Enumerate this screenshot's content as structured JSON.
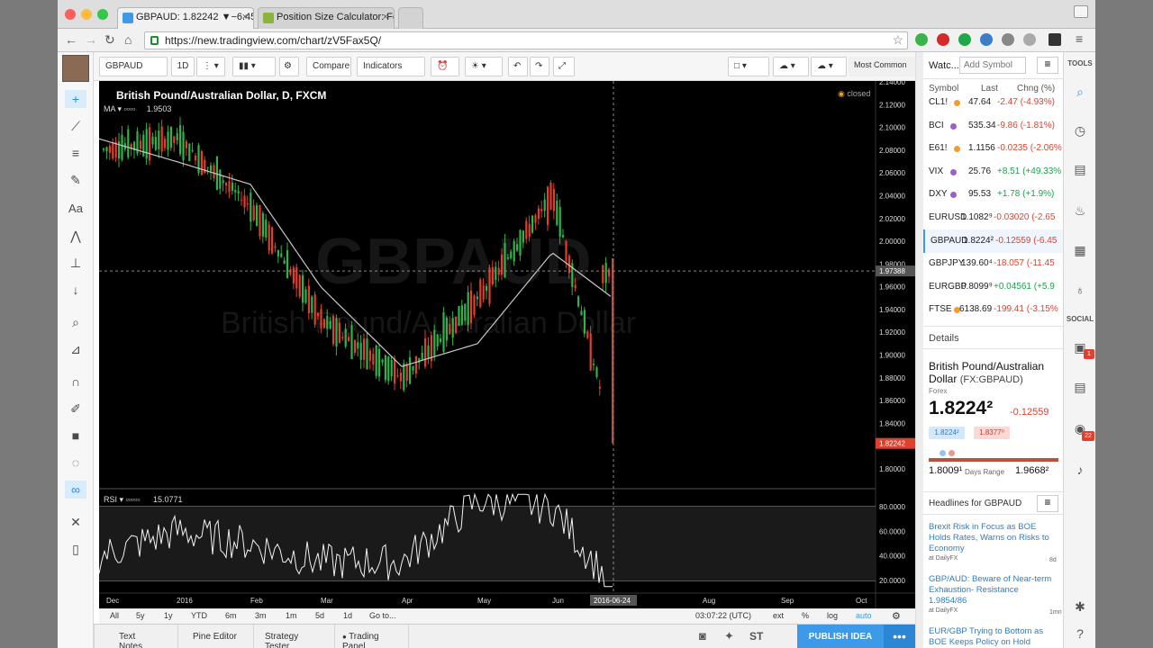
{
  "browser": {
    "tabs": [
      {
        "title": "GBPAUD: 1.82242 ▼−6.45",
        "active": true
      },
      {
        "title": "Position Size Calculator: Fo",
        "active": false
      }
    ],
    "url": "https://new.tradingview.com/chart/zV5Fax5Q/"
  },
  "toolbar": {
    "symbol": "GBPAUD",
    "interval": "1D",
    "compare": "Compare",
    "indicators": "Indicators",
    "most_common": "Most Common"
  },
  "chart": {
    "title": "British Pound/Australian Dollar, D, FXCM",
    "status": "closed",
    "ma_label": "MA",
    "ma_value": "1.9503",
    "rsi_label": "RSI",
    "rsi_value": "15.0771",
    "watermark_symbol": "GBPAUD",
    "watermark_name": "British Pound/Australian Dollar",
    "last_price_tag": "1.82242",
    "crosshair_price_tag": "1.97388",
    "crosshair_date_tag": "2016-06-24",
    "price_ticks": [
      "2.14000",
      "2.12000",
      "2.10000",
      "2.08000",
      "2.06000",
      "2.04000",
      "2.02000",
      "2.00000",
      "1.98000",
      "1.96000",
      "1.94000",
      "1.92000",
      "1.90000",
      "1.88000",
      "1.86000",
      "1.84000",
      "1.82000",
      "1.80000"
    ],
    "rsi_ticks": [
      "80.0000",
      "60.0000",
      "40.0000",
      "20.0000"
    ],
    "date_ticks": [
      "Dec",
      "2016",
      "Feb",
      "Mar",
      "Apr",
      "May",
      "Jun",
      "Aug",
      "Sep",
      "Oct"
    ]
  },
  "chart_data": {
    "type": "line",
    "title": "British Pound/Australian Dollar, D, FXCM",
    "xlabel": "",
    "ylabel": "",
    "ylim": [
      1.79,
      2.145
    ],
    "x": [
      "Dec",
      "2016",
      "Feb",
      "Mar",
      "Apr",
      "May",
      "Jun",
      "2016-06-24"
    ],
    "series": [
      {
        "name": "GBPAUD",
        "values": [
          2.08,
          2.09,
          2.03,
          1.93,
          1.88,
          1.95,
          2.04,
          1.82242
        ]
      },
      {
        "name": "MA",
        "values": [
          2.09,
          2.07,
          2.05,
          1.96,
          1.89,
          1.91,
          1.99,
          1.9503
        ]
      },
      {
        "name": "RSI",
        "values": [
          40,
          60,
          50,
          35,
          35,
          85,
          80,
          15.0771
        ]
      }
    ],
    "grid": false,
    "legend": "top-left"
  },
  "range_bar": {
    "buttons": [
      "All",
      "5y",
      "1y",
      "YTD",
      "6m",
      "3m",
      "1m",
      "5d",
      "1d",
      "Go to..."
    ],
    "time": "03:07:22 (UTC)",
    "ext": "ext",
    "pct": "%",
    "log": "log",
    "auto": "auto"
  },
  "bottom_bar": {
    "tabs": [
      "Text Notes",
      "Pine Editor",
      "Strategy Tester",
      "Trading Panel"
    ],
    "publish": "PUBLISH IDEA",
    "more": "•••",
    "st": "ST"
  },
  "watchlist": {
    "title": "Watc...",
    "add_placeholder": "Add Symbol",
    "columns": [
      "Symbol",
      "Last",
      "Chng (%)"
    ],
    "rows": [
      {
        "symbol": "CL1!",
        "last": "47.64",
        "change": "-2.47 (-4.93%)",
        "dir": "neg",
        "dot": "o"
      },
      {
        "symbol": "BCI",
        "last": "535.34",
        "change": "-9.86 (-1.81%)",
        "dir": "neg",
        "dot": "p"
      },
      {
        "symbol": "E61!",
        "last": "1.1156",
        "change": "-0.0235 (-2.06%",
        "dir": "neg",
        "dot": "o"
      },
      {
        "symbol": "VIX",
        "last": "25.76",
        "change": "+8.51 (+49.33%",
        "dir": "pos",
        "dot": "p"
      },
      {
        "symbol": "DXY",
        "last": "95.53",
        "change": "+1.78 (+1.9%)",
        "dir": "pos",
        "dot": "p"
      },
      {
        "symbol": "EURUSD",
        "last": "1.1082⁹",
        "change": "-0.03020 (-2.65",
        "dir": "neg",
        "dot": ""
      },
      {
        "symbol": "GBPAUD",
        "last": "1.8224²",
        "change": "-0.12559 (-6.45",
        "dir": "neg",
        "dot": ""
      },
      {
        "symbol": "GBPJPY",
        "last": "139.60⁴",
        "change": "-18.057 (-11.45",
        "dir": "neg",
        "dot": ""
      },
      {
        "symbol": "EURGBP",
        "last": "0.8099⁹",
        "change": "+0.04561 (+5.9",
        "dir": "pos",
        "dot": ""
      },
      {
        "symbol": "FTSE",
        "last": "6138.69",
        "change": "-199.41 (-3.15%",
        "dir": "neg",
        "dot": "o"
      }
    ],
    "details_label": "Details",
    "details_name": "British Pound/Australian Dollar",
    "details_ticker": "(FX:GBPAUD)",
    "details_type": "Forex",
    "details_price": "1.8224²",
    "details_change": "-0.12559",
    "bid": "1.8224²",
    "ask": "1.8377⁰",
    "range_low": "1.8009¹",
    "range_label": "Days Range",
    "range_high": "1.9668²",
    "headlines_title": "Headlines for GBPAUD",
    "headlines": [
      {
        "text": "Brexit Risk in Focus as BOE Holds Rates, Warns on Risks to Economy",
        "source": "at DailyFX",
        "age": "8d"
      },
      {
        "text": "GBP/AUD: Beware of Near-term Exhaustion- Resistance 1.9854/86",
        "source": "at DailyFX",
        "age": "1mn"
      },
      {
        "text": "EUR/GBP Trying to Bottom as BOE Keeps Policy on Hold",
        "source": "",
        "age": ""
      }
    ]
  },
  "right_tools": {
    "tools_label": "TOOLS",
    "social_label": "SOCIAL",
    "badge1": "1",
    "badge2": "22"
  },
  "colors": {
    "accent": "#3c9ae8",
    "up": "#17a34a",
    "down": "#e0412f",
    "chart_bg": "#000000"
  }
}
